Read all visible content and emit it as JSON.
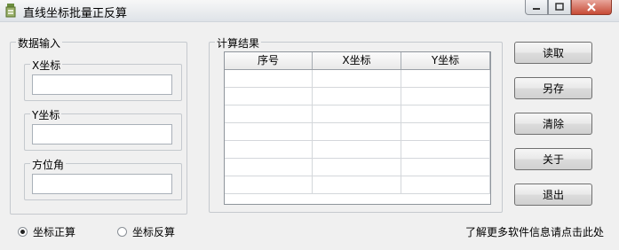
{
  "window": {
    "title": "直线坐标批量正反算"
  },
  "input_group": {
    "legend": "数据输入",
    "x_label": "X坐标",
    "x_value": "",
    "y_label": "Y坐标",
    "y_value": "",
    "azimuth_label": "方位角",
    "azimuth_value": ""
  },
  "result_group": {
    "legend": "计算结果",
    "columns": [
      "序号",
      "X坐标",
      "Y坐标"
    ],
    "rows": [
      [
        "",
        "",
        ""
      ],
      [
        "",
        "",
        ""
      ],
      [
        "",
        "",
        ""
      ],
      [
        "",
        "",
        ""
      ],
      [
        "",
        "",
        ""
      ],
      [
        "",
        "",
        ""
      ],
      [
        "",
        "",
        ""
      ]
    ]
  },
  "buttons": {
    "read": "读取",
    "save_as": "另存",
    "clear": "清除",
    "about": "关于",
    "exit": "退出"
  },
  "mode": {
    "forward": "坐标正算",
    "inverse": "坐标反算",
    "selected": "forward"
  },
  "info_link": "了解更多软件信息请点击此处"
}
